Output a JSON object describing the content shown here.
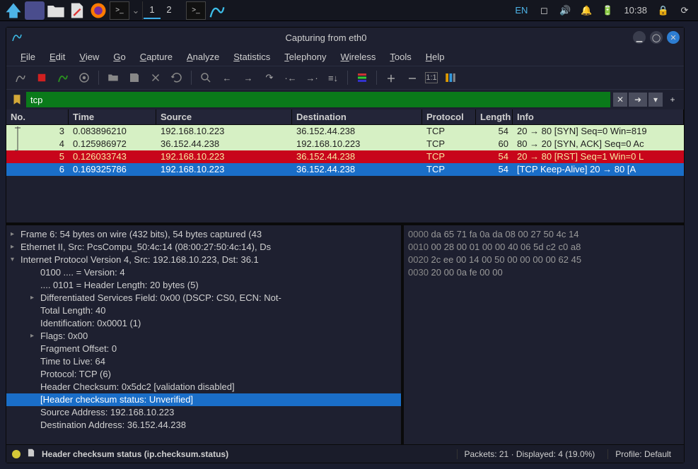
{
  "taskbar": {
    "lang": "EN",
    "time": "10:38",
    "workspace1": "1",
    "workspace2": "2"
  },
  "window": {
    "title": "Capturing from eth0"
  },
  "menu": {
    "file": "File",
    "edit": "Edit",
    "view": "View",
    "go": "Go",
    "capture": "Capture",
    "analyze": "Analyze",
    "statistics": "Statistics",
    "telephony": "Telephony",
    "wireless": "Wireless",
    "tools": "Tools",
    "help": "Help"
  },
  "filter": {
    "value": "tcp",
    "plus": "+"
  },
  "columns": {
    "no": "No.",
    "time": "Time",
    "src": "Source",
    "dst": "Destination",
    "proto": "Protocol",
    "len": "Length",
    "info": "Info"
  },
  "packets": [
    {
      "no": "3",
      "time": "0.083896210",
      "src": "192.168.10.223",
      "dst": "36.152.44.238",
      "proto": "TCP",
      "len": "54",
      "info": "20 → 80 [SYN] Seq=0 Win=819",
      "cls": "r-syn"
    },
    {
      "no": "4",
      "time": "0.125986972",
      "src": "36.152.44.238",
      "dst": "192.168.10.223",
      "proto": "TCP",
      "len": "60",
      "info": "80 → 20 [SYN, ACK] Seq=0 Ac",
      "cls": "r-syn"
    },
    {
      "no": "5",
      "time": "0.126033743",
      "src": "192.168.10.223",
      "dst": "36.152.44.238",
      "proto": "TCP",
      "len": "54",
      "info": "20 → 80 [RST] Seq=1 Win=0 L",
      "cls": "r-rst"
    },
    {
      "no": "6",
      "time": "0.169325786",
      "src": "192.168.10.223",
      "dst": "36.152.44.238",
      "proto": "TCP",
      "len": "54",
      "info": "[TCP Keep-Alive] 20 → 80 [A",
      "cls": "r-sel"
    }
  ],
  "details": [
    {
      "txt": "Frame 6: 54 bytes on wire (432 bits), 54 bytes captured (43",
      "cls": "exp"
    },
    {
      "txt": "Ethernet II, Src: PcsCompu_50:4c:14 (08:00:27:50:4c:14), Ds",
      "cls": "exp"
    },
    {
      "txt": "Internet Protocol Version 4, Src: 192.168.10.223, Dst: 36.1",
      "cls": "expd"
    },
    {
      "txt": "0100 .... = Version: 4",
      "cls": "indent"
    },
    {
      "txt": ".... 0101 = Header Length: 20 bytes (5)",
      "cls": "indent"
    },
    {
      "txt": "Differentiated Services Field: 0x00 (DSCP: CS0, ECN: Not-",
      "cls": "indent exp"
    },
    {
      "txt": "Total Length: 40",
      "cls": "indent"
    },
    {
      "txt": "Identification: 0x0001 (1)",
      "cls": "indent"
    },
    {
      "txt": "Flags: 0x00",
      "cls": "indent exp"
    },
    {
      "txt": "Fragment Offset: 0",
      "cls": "indent"
    },
    {
      "txt": "Time to Live: 64",
      "cls": "indent"
    },
    {
      "txt": "Protocol: TCP (6)",
      "cls": "indent"
    },
    {
      "txt": "Header Checksum: 0x5dc2 [validation disabled]",
      "cls": "indent"
    },
    {
      "txt": "[Header checksum status: Unverified]",
      "cls": "indent sel"
    },
    {
      "txt": "Source Address: 192.168.10.223",
      "cls": "indent"
    },
    {
      "txt": "Destination Address: 36.152.44.238",
      "cls": "indent"
    }
  ],
  "hex": [
    {
      "o": "0000",
      "b": "da 65 71 fa 0a da 08 00  27 50 4c 14"
    },
    {
      "o": "0010",
      "b": "00 28 00 01 00 00 40 06  5d c2 c0 a8"
    },
    {
      "o": "0020",
      "b": "2c ee 00 14 00 50 00 00  00 00 62 45"
    },
    {
      "o": "0030",
      "b": "20 00 0a fe 00 00"
    }
  ],
  "status": {
    "field": "Header checksum status (ip.checksum.status)",
    "packets": "Packets: 21 · Displayed: 4 (19.0%)",
    "profile": "Profile: Default"
  }
}
